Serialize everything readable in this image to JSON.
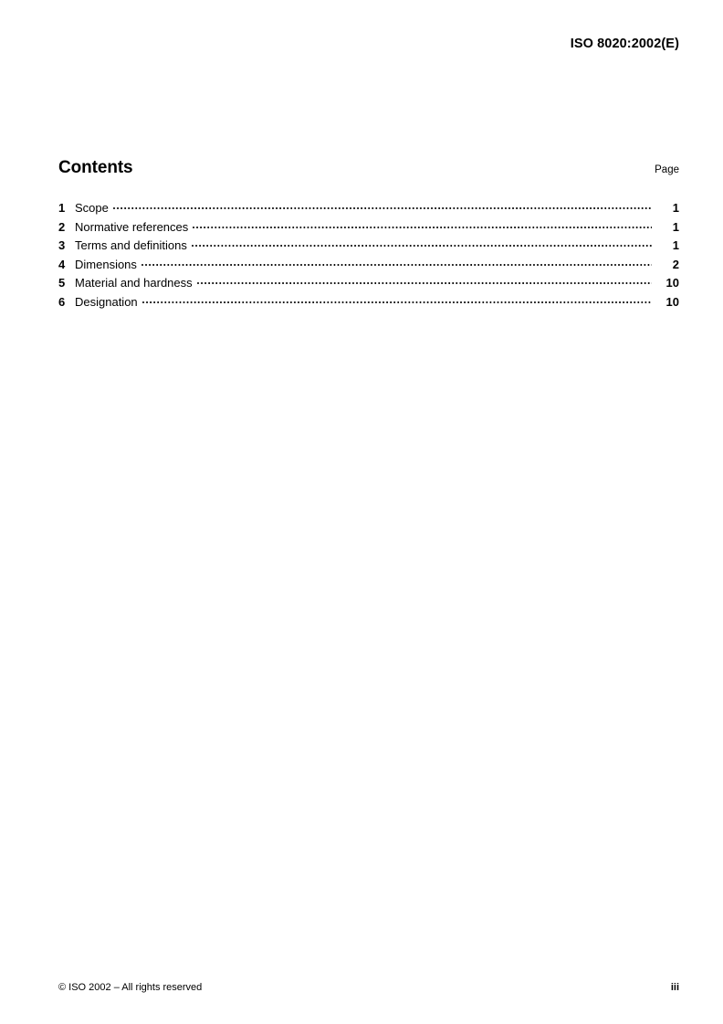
{
  "header": {
    "standard_ref": "ISO 8020:2002(E)"
  },
  "contents": {
    "title": "Contents",
    "page_column_label": "Page",
    "entries": [
      {
        "number": "1",
        "label": "Scope",
        "page": "1"
      },
      {
        "number": "2",
        "label": "Normative references",
        "page": "1"
      },
      {
        "number": "3",
        "label": "Terms and definitions",
        "page": "1"
      },
      {
        "number": "4",
        "label": "Dimensions",
        "page": "2"
      },
      {
        "number": "5",
        "label": "Material and hardness",
        "page": "10"
      },
      {
        "number": "6",
        "label": "Designation",
        "page": "10"
      }
    ]
  },
  "footer": {
    "copyright": "© ISO 2002 – All rights reserved",
    "page_number": "iii"
  }
}
